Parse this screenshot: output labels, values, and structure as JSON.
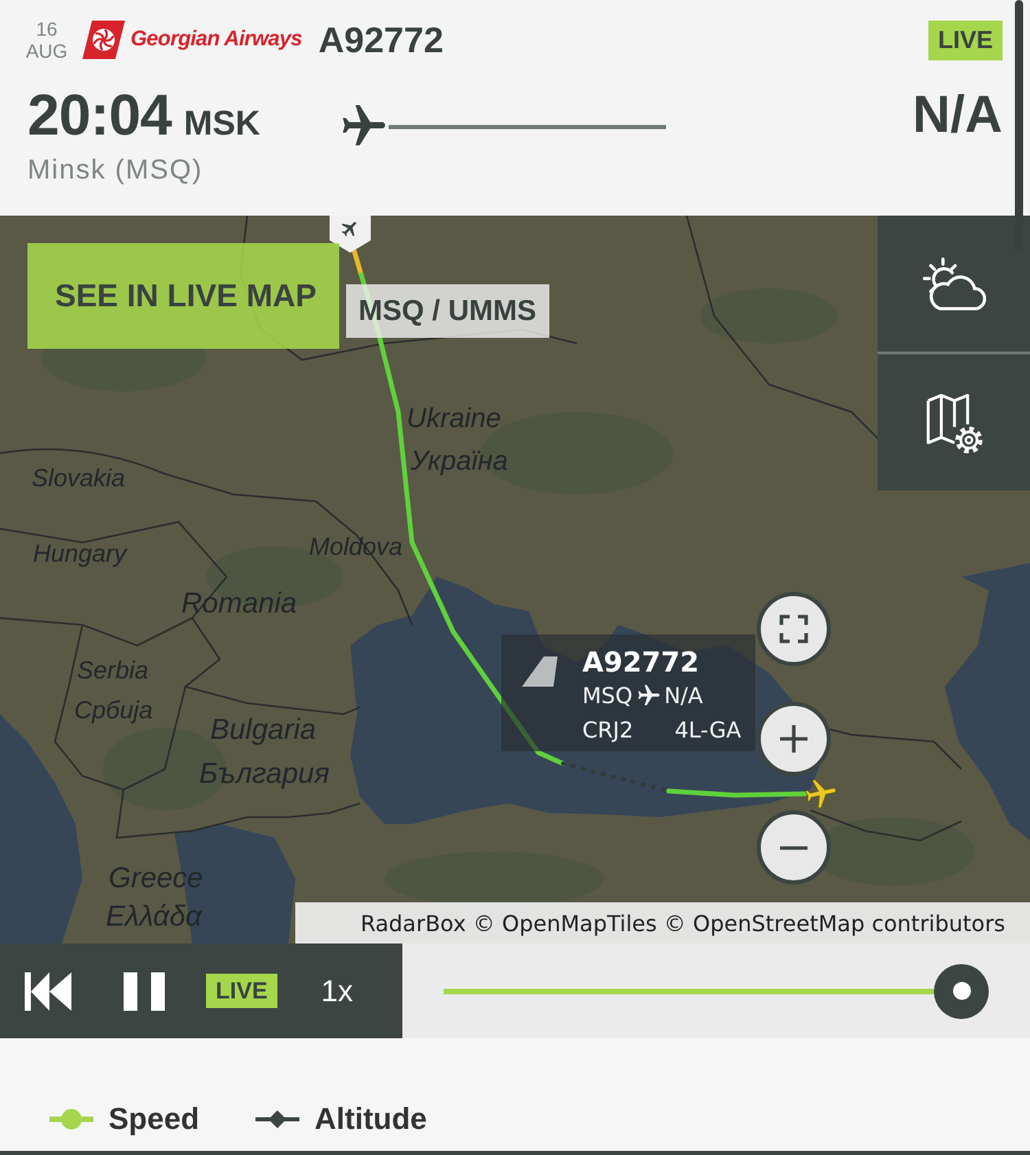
{
  "header": {
    "date_day": "16",
    "date_month": "AUG",
    "airline": "Georgian Airways",
    "flight": "A92772",
    "status_badge": "LIVE",
    "departure_time": "20:04",
    "departure_timezone": "MSK",
    "origin": "Minsk (MSQ)",
    "arrival_time": "N/A"
  },
  "map": {
    "live_map_button": "SEE IN LIVE MAP",
    "airport_label": "MSQ / UMMS",
    "country_labels": [
      "Ukraine",
      "Україна",
      "Slovakia",
      "Hungary",
      "Moldova",
      "Romania",
      "Serbia",
      "Србија",
      "Bulgaria",
      "България",
      "Greece",
      "Ελλάδα"
    ],
    "tooltip": {
      "flight": "A92772",
      "origin": "MSQ",
      "destination": "N/A",
      "aircraft": "CRJ2",
      "registration": "4L-GA"
    },
    "attribution": "RadarBox © OpenMapTiles © OpenStreetMap contributors"
  },
  "player": {
    "playing": true,
    "live_badge": "LIVE",
    "speed": "1x",
    "timeline": {
      "level": 1
    }
  },
  "legend": [
    {
      "label": "Speed",
      "kind": "circle",
      "color": "#a5d64c"
    },
    {
      "label": "Altitude",
      "kind": "diamond",
      "color": "#3d4542"
    }
  ]
}
